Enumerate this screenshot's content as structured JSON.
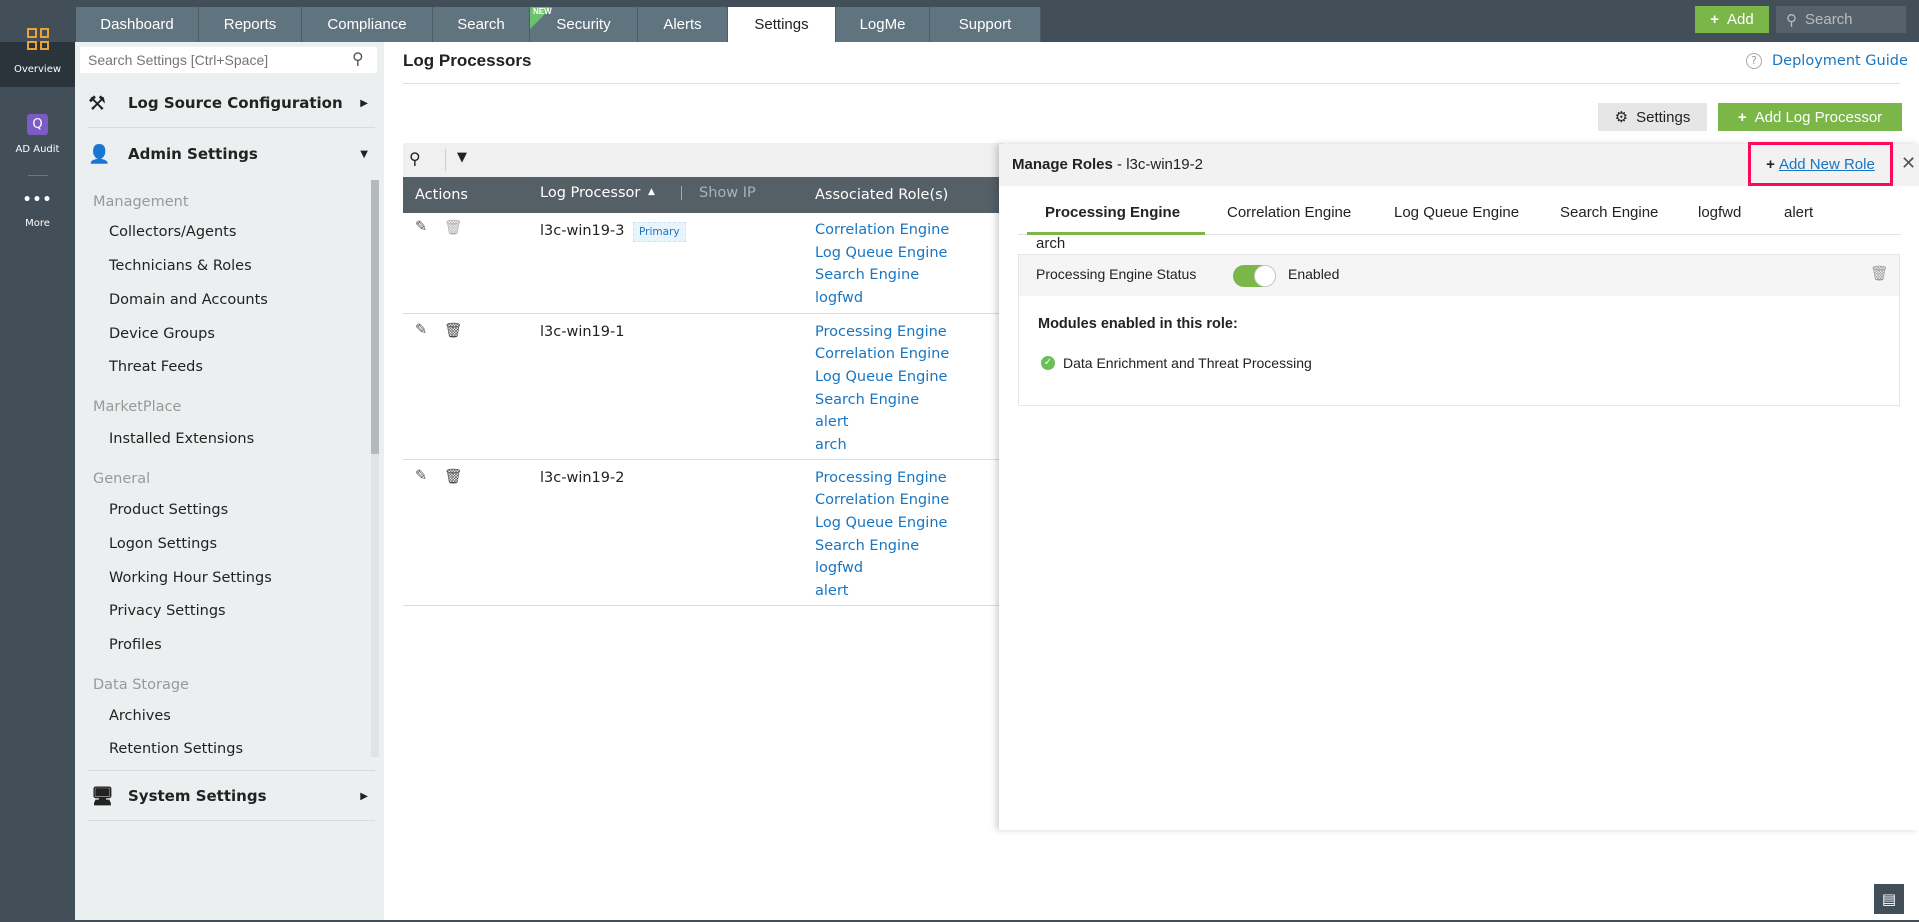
{
  "nav": {
    "tabs": [
      "Dashboard",
      "Reports",
      "Compliance",
      "Search",
      "Security",
      "Alerts",
      "Settings",
      "LogMe",
      "Support"
    ],
    "active": "Settings",
    "new_badge": "NEW",
    "add_label": "Add",
    "search_placeholder": "Search"
  },
  "rail": {
    "items": [
      {
        "label": "Overview",
        "icon": "grid-icon"
      },
      {
        "label": "AD Audit",
        "icon": "ad-audit-icon"
      },
      {
        "label": "More",
        "icon": "more-icon"
      }
    ]
  },
  "sidebar": {
    "search_placeholder": "Search Settings [Ctrl+Space]",
    "log_source": "Log Source Configuration",
    "admin": "Admin Settings",
    "system": "System Settings",
    "groups": [
      {
        "title": "Management",
        "items": [
          "Collectors/Agents",
          "Technicians & Roles",
          "Domain and Accounts",
          "Device Groups",
          "Threat Feeds"
        ]
      },
      {
        "title": "MarketPlace",
        "items": [
          "Installed Extensions"
        ]
      },
      {
        "title": "General",
        "items": [
          "Product Settings",
          "Logon Settings",
          "Working Hour Settings",
          "Privacy Settings",
          "Profiles"
        ]
      },
      {
        "title": "Data Storage",
        "items": [
          "Archives",
          "Retention Settings"
        ]
      }
    ]
  },
  "main": {
    "title": "Log Processors",
    "deployment_guide": "Deployment Guide",
    "settings_label": "Settings",
    "add_processor_label": "Add Log Processor",
    "columns": {
      "actions": "Actions",
      "processor": "Log Processor",
      "show_ip": "Show IP",
      "roles": "Associated Role(s)"
    },
    "rows": [
      {
        "name": "l3c-win19-3",
        "badge": "Primary",
        "roles": [
          "Correlation Engine",
          "Log Queue Engine",
          "Search Engine",
          "logfwd"
        ]
      },
      {
        "name": "l3c-win19-1",
        "roles": [
          "Processing Engine",
          "Correlation Engine",
          "Log Queue Engine",
          "Search Engine",
          "alert",
          "arch"
        ]
      },
      {
        "name": "l3c-win19-2",
        "roles": [
          "Processing Engine",
          "Correlation Engine",
          "Log Queue Engine",
          "Search Engine",
          "logfwd",
          "alert"
        ]
      }
    ]
  },
  "panel": {
    "title": "Manage Roles",
    "subtitle": "- l3c-win19-2",
    "add_role": "Add New Role",
    "tabs": [
      "Processing Engine",
      "Correlation Engine",
      "Log Queue Engine",
      "Search Engine",
      "logfwd",
      "alert",
      "arch"
    ],
    "status_label": "Processing Engine Status",
    "status_value": "Enabled",
    "modules_heading": "Modules enabled in this role:",
    "modules": [
      "Data Enrichment and Threat Processing"
    ]
  },
  "colors": {
    "accent": "#7ab648",
    "highlight": "#ff0a5a",
    "link": "#1a75c0"
  }
}
